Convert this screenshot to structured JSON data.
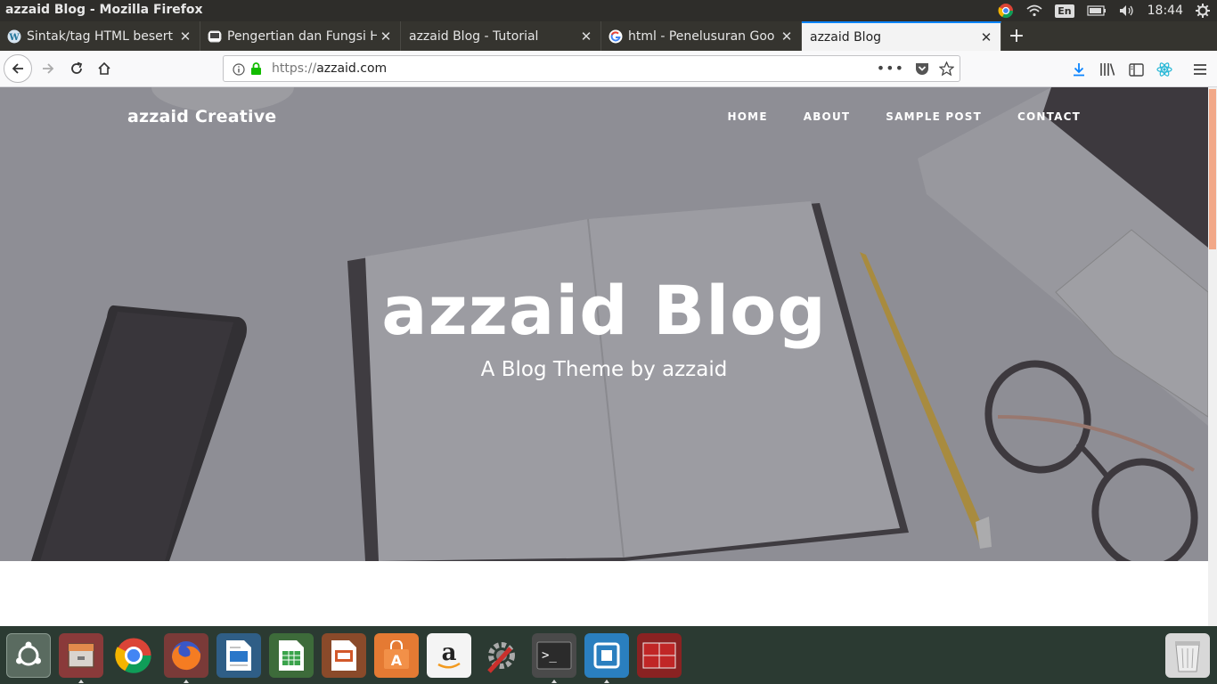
{
  "window": {
    "title": "azzaid Blog - Mozilla Firefox"
  },
  "system_tray": {
    "language": "En",
    "time": "18:44"
  },
  "tabs": [
    {
      "label": "Sintak/tag HTML besert",
      "favicon": "wordpress-icon"
    },
    {
      "label": "Pengertian dan Fungsi H",
      "favicon": "page-icon"
    },
    {
      "label": "azzaid Blog - Tutorial",
      "favicon": ""
    },
    {
      "label": "html - Penelusuran Goo",
      "favicon": "google-icon"
    },
    {
      "label": "azzaid Blog",
      "favicon": ""
    }
  ],
  "address_bar": {
    "scheme": "https://",
    "host": "azzaid.com"
  },
  "site": {
    "brand": "azzaid Creative",
    "nav": [
      "HOME",
      "ABOUT",
      "SAMPLE POST",
      "CONTACT"
    ],
    "hero_title": "azzaid Blog",
    "hero_subtitle": "A Blog Theme by azzaid"
  },
  "dock": [
    "ubuntu-icon",
    "files-icon",
    "chrome-icon",
    "firefox-icon",
    "writer-icon",
    "calc-icon",
    "impress-icon",
    "software-center-icon",
    "amazon-icon",
    "system-settings-icon",
    "terminal-icon",
    "vmware-icon",
    "remote-desktop-icon",
    "trash-icon"
  ],
  "colors": {
    "accent": "#0a84ff",
    "hero_overlay": "#8f8f96",
    "scroll_thumb": "#f2a888",
    "dock_bg": "#2b3a32"
  }
}
